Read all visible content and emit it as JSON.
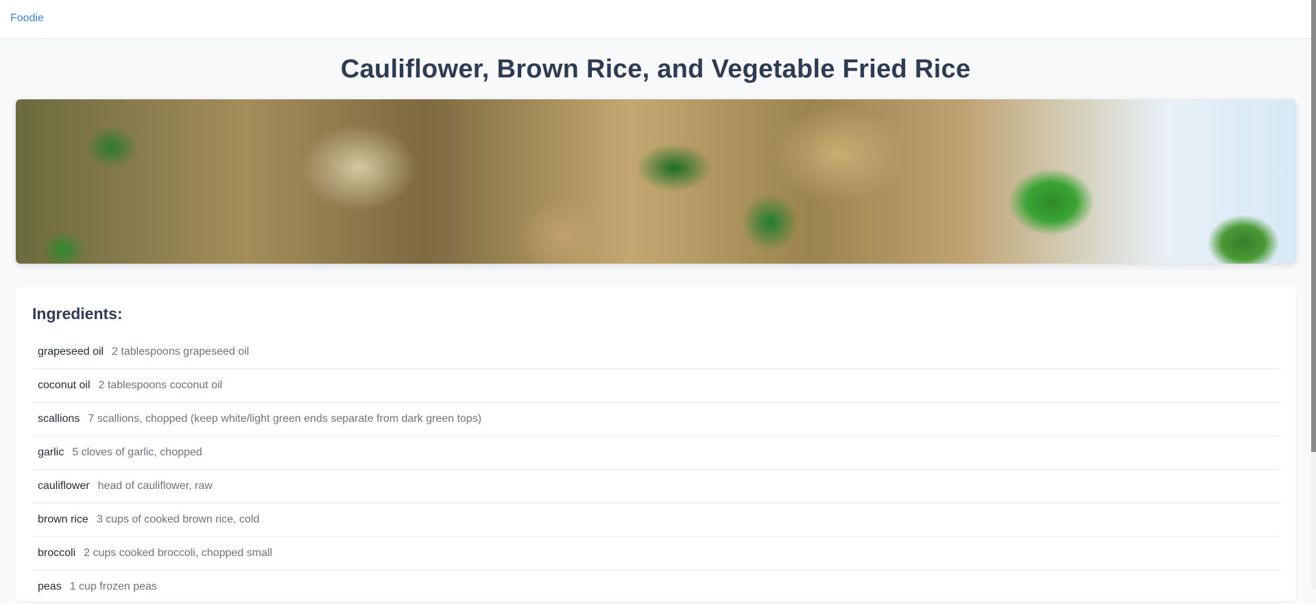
{
  "nav": {
    "brand": "Foodie"
  },
  "recipe": {
    "title": "Cauliflower, Brown Rice, and Vegetable Fried Rice",
    "image_alt": "fried rice with peas and broccoli",
    "ingredients_heading": "Ingredients:",
    "ingredients": [
      {
        "name": "grapeseed oil",
        "desc": "2 tablespoons grapeseed oil"
      },
      {
        "name": "coconut oil",
        "desc": "2 tablespoons coconut oil"
      },
      {
        "name": "scallions",
        "desc": "7 scallions, chopped (keep white/light green ends separate from dark green tops)"
      },
      {
        "name": "garlic",
        "desc": "5 cloves of garlic, chopped"
      },
      {
        "name": "cauliflower",
        "desc": "head of cauliflower, raw"
      },
      {
        "name": "brown rice",
        "desc": "3 cups of cooked brown rice, cold"
      },
      {
        "name": "broccoli",
        "desc": "2 cups cooked broccoli, chopped small"
      },
      {
        "name": "peas",
        "desc": "1 cup frozen peas"
      }
    ]
  },
  "colors": {
    "accent": "#3b82d6",
    "title": "#2f3b52",
    "muted_text": "#6b7280"
  }
}
